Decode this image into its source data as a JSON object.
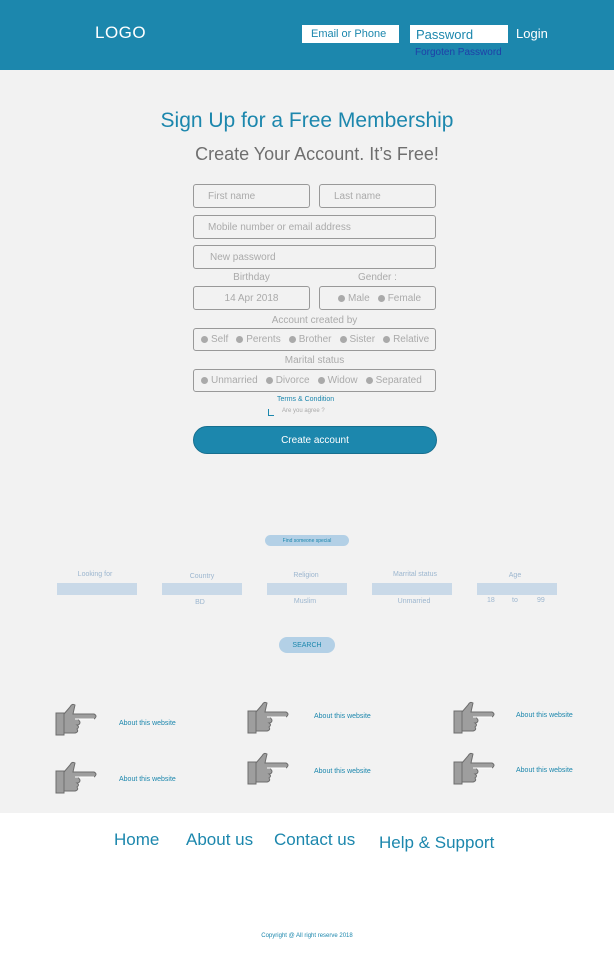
{
  "header": {
    "logo": "LOGO",
    "email_placeholder": "Email or Phone",
    "password_placeholder": "Password",
    "login_label": "Login",
    "forgot_label": "Forgoten Password"
  },
  "signup": {
    "title": "Sign Up for a Free Membership",
    "subtitle": "Create Your Account. It’s Free!",
    "first_name_placeholder": "First name",
    "last_name_placeholder": "Last name",
    "mobile_placeholder": "Mobile number or email address",
    "password_placeholder": "New password",
    "birthday_label": "Birthday",
    "birthday_value": "14 Apr 2018",
    "gender_label": "Gender :",
    "gender_options": [
      "Male",
      "Female"
    ],
    "created_by_label": "Account created by",
    "created_by_options": [
      "Self",
      "Perents",
      "Brother",
      "Sister",
      "Relative"
    ],
    "marital_label": "Marital status",
    "marital_options": [
      "Unmarried",
      "Divorce",
      "Widow",
      "Separated"
    ],
    "terms_label": "Terms & Condition",
    "agree_label": "Are you agree ?",
    "create_label": "Create account"
  },
  "search": {
    "find_label": "Find someone special",
    "looking_for_label": "Looking for",
    "country_label": "Country",
    "country_value": "BD",
    "religion_label": "Religion",
    "religion_value": "Muslim",
    "marital_label": "Marrital status",
    "marital_value": "Unmarried",
    "age_label": "Age",
    "age_from": "18",
    "age_to_label": "to",
    "age_to": "99",
    "search_label": "SEARCH"
  },
  "features": {
    "items": [
      {
        "label": "About this website",
        "icon": "pointing-hand-icon"
      },
      {
        "label": "About this website",
        "icon": "pointing-hand-icon"
      },
      {
        "label": "About this website",
        "icon": "pointing-hand-icon"
      },
      {
        "label": "About this website",
        "icon": "pointing-hand-icon"
      },
      {
        "label": "About this website",
        "icon": "pointing-hand-icon"
      },
      {
        "label": "About this website",
        "icon": "pointing-hand-icon"
      }
    ]
  },
  "footer": {
    "nav": [
      "Home",
      "About us",
      "Contact us",
      "Help & Support"
    ],
    "copyright": "Copyright @ All right reserve 2018"
  },
  "colors": {
    "brand": "#1c87ad",
    "background": "#f2f2f2"
  }
}
